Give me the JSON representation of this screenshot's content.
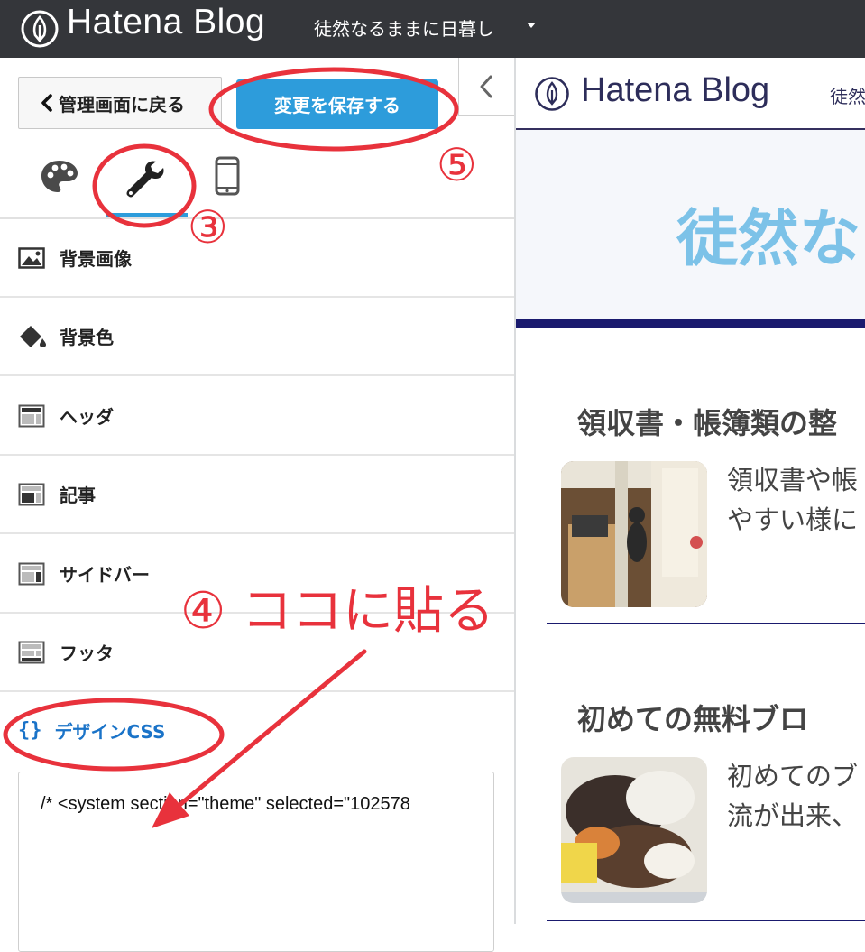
{
  "topbar": {
    "brand": "Hatena Blog",
    "blog_name": "徒然なるままに日暮し"
  },
  "sidebar": {
    "back_label": "管理画面に戻る",
    "save_label": "変更を保存する",
    "tabs": [
      {
        "icon": "palette-icon"
      },
      {
        "icon": "wrench-icon",
        "active": true
      },
      {
        "icon": "smartphone-icon"
      }
    ],
    "items": [
      {
        "label": "背景画像",
        "icon": "image-icon"
      },
      {
        "label": "背景色",
        "icon": "paint-bucket-icon"
      },
      {
        "label": "ヘッダ",
        "icon": "layout-header-icon"
      },
      {
        "label": "記事",
        "icon": "layout-article-icon"
      },
      {
        "label": "サイドバー",
        "icon": "layout-sidebar-icon"
      },
      {
        "label": "フッタ",
        "icon": "layout-footer-icon"
      }
    ],
    "design_css": {
      "braces": "{}",
      "label": "デザインCSS",
      "code": "/* <system section=\"theme\" selected=\"102578"
    }
  },
  "preview": {
    "brand": "Hatena Blog",
    "blog_name_partial": "徒然",
    "hero_title_partial": "徒然な",
    "articles": [
      {
        "title": "領収書・帳簿類の整",
        "excerpt_line1": "領収書や帳",
        "excerpt_line2": "やすい様に"
      },
      {
        "title": "初めての無料ブロ",
        "excerpt_line1": "初めてのブ",
        "excerpt_line2": "流が出来、"
      }
    ]
  },
  "annotations": {
    "step3": "③",
    "step4": "④ ココに貼る",
    "step5": "⑤",
    "color": "#e8323c"
  },
  "colors": {
    "topbar": "#34363a",
    "accent": "#2d9cdb",
    "css_link": "#1a73c8",
    "preview_navy": "#1a1a6e",
    "preview_title": "#7cc2e8"
  }
}
